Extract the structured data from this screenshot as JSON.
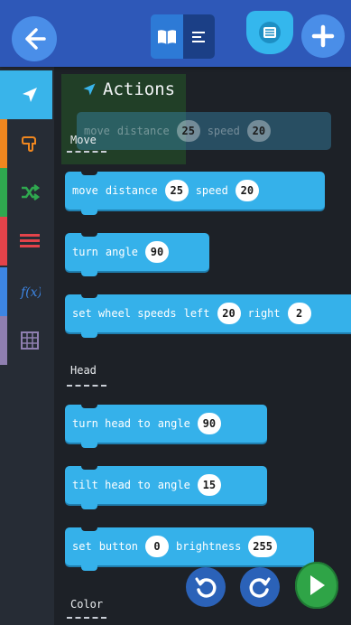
{
  "toolbar": {
    "back_icon": "arrow-left-icon",
    "view_toggle_active": "blocks-view",
    "library_icon": "book-icon",
    "add_icon": "plus-icon"
  },
  "categories": [
    {
      "name": "Actions",
      "icon": "send-icon",
      "color": "#39b4ea",
      "active": true
    },
    {
      "name": "Looks",
      "icon": "hand-icon",
      "color": "#f0871f"
    },
    {
      "name": "Control",
      "icon": "shuffle-icon",
      "color": "#2fa84f"
    },
    {
      "name": "Data",
      "icon": "list-icon",
      "color": "#e3434a"
    },
    {
      "name": "Functions",
      "icon": "function-icon",
      "color": "#3d86e4"
    },
    {
      "name": "Tables",
      "icon": "table-icon",
      "color": "#8f7fb0"
    }
  ],
  "flyout": {
    "title": "Actions",
    "sections": {
      "move": "Move",
      "head": "Head",
      "color": "Color"
    },
    "ghost_block": {
      "w1": "move",
      "w2": "distance",
      "v1": "25",
      "w3": "speed",
      "v2": "20"
    },
    "blocks": {
      "move": {
        "w1": "move",
        "w2": "distance",
        "v1": "25",
        "w3": "speed",
        "v2": "20"
      },
      "turn": {
        "w1": "turn",
        "w2": "angle",
        "v1": "90"
      },
      "wheels": {
        "w1": "set wheel speeds",
        "w2": "left",
        "v1": "20",
        "w3": "right",
        "v2": "2"
      },
      "turn_head": {
        "w1": "turn head to",
        "w2": "angle",
        "v1": "90"
      },
      "tilt_head": {
        "w1": "tilt head to",
        "w2": "angle",
        "v1": "15"
      },
      "button": {
        "w1": "set",
        "w2": "button",
        "v1": "0",
        "w3": "brightness",
        "v2": "255"
      }
    }
  },
  "controls": {
    "undo_icon": "undo-icon",
    "redo_icon": "redo-icon",
    "run_icon": "play-icon"
  },
  "colors": {
    "topbar": "#2e58b8",
    "block": "#35b1ea",
    "run": "#2fa447"
  }
}
